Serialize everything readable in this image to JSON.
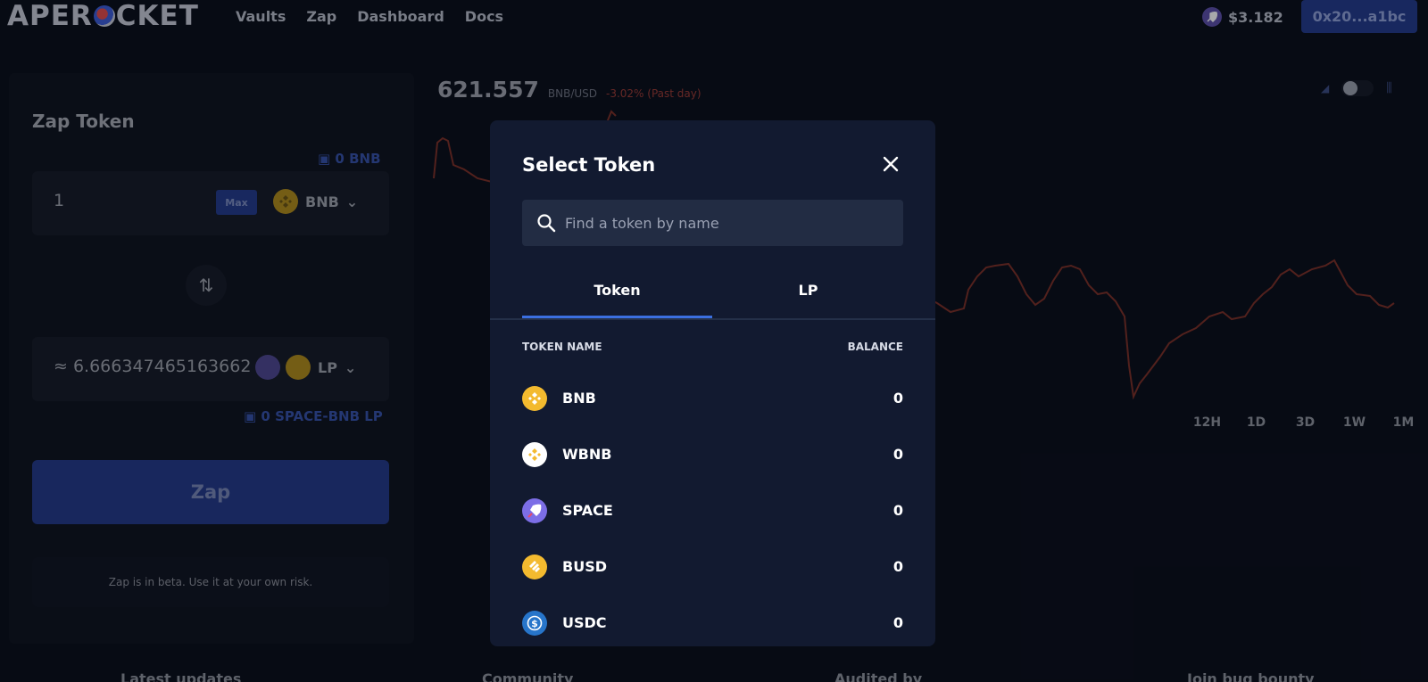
{
  "header": {
    "logo_prefix": "APER",
    "logo_suffix": "CKET",
    "nav": [
      "Vaults",
      "Zap",
      "Dashboard",
      "Docs"
    ],
    "price": "$3.182",
    "wallet": "0x20...a1bc"
  },
  "zap": {
    "title": "Zap Token",
    "from_balance": "0 BNB",
    "from_amount": "1",
    "max_label": "Max",
    "from_token": "BNB",
    "to_amount": "≈ 6.666347465163662",
    "to_token": "LP",
    "to_balance": "0 SPACE-BNB LP",
    "zap_label": "Zap",
    "beta_note": "Zap is in beta. Use it at your own risk."
  },
  "chart": {
    "price": "621.557",
    "pair": "BNB/USD",
    "change": "-3.02% (Past day)",
    "ranges": [
      "12H",
      "1D",
      "3D",
      "1W",
      "1M"
    ]
  },
  "footer": [
    "Latest updates",
    "Community",
    "Audited by",
    "Join bug bounty"
  ],
  "modal": {
    "title": "Select Token",
    "search_placeholder": "Find a token by name",
    "tabs": [
      "Token",
      "LP"
    ],
    "col_name": "TOKEN NAME",
    "col_balance": "BALANCE",
    "tokens": [
      {
        "name": "BNB",
        "balance": "0",
        "icon": "bnb-icon"
      },
      {
        "name": "WBNB",
        "balance": "0",
        "icon": "wbnb-icon"
      },
      {
        "name": "SPACE",
        "balance": "0",
        "icon": "space-rocket-icon"
      },
      {
        "name": "BUSD",
        "balance": "0",
        "icon": "busd-icon"
      },
      {
        "name": "USDC",
        "balance": "0",
        "icon": "usdc-icon"
      }
    ]
  },
  "colors": {
    "accent": "#3b6fe0",
    "bnb": "#f3ba2f",
    "chart_line": "#b4432f",
    "modal_bg": "#121a30"
  }
}
